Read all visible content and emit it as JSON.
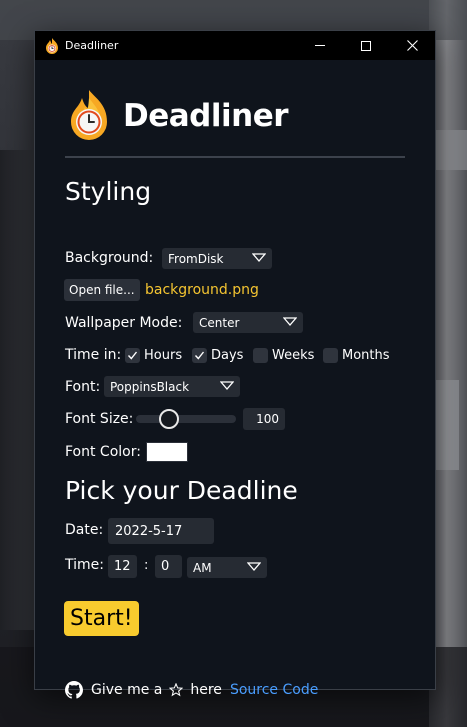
{
  "window": {
    "title": "Deadliner"
  },
  "header": {
    "app_name": "Deadliner"
  },
  "styling": {
    "heading": "Styling",
    "background_label": "Background:",
    "background_value": "FromDisk",
    "open_file_label": "Open file...",
    "file_name": "background.png",
    "wallpaper_mode_label": "Wallpaper Mode:",
    "wallpaper_mode_value": "Center",
    "time_in_label": "Time in:",
    "time_units": [
      {
        "label": "Hours",
        "checked": true
      },
      {
        "label": "Days",
        "checked": true
      },
      {
        "label": "Weeks",
        "checked": false
      },
      {
        "label": "Months",
        "checked": false
      }
    ],
    "font_label": "Font:",
    "font_value": "PoppinsBlack",
    "font_size_label": "Font Size:",
    "font_size_value": "100",
    "font_size_slider_level": 0.33,
    "font_color_label": "Font Color:",
    "font_color_value": "#ffffff"
  },
  "deadline": {
    "heading": "Pick your Deadline",
    "date_label": "Date:",
    "date_value": "2022-5-17",
    "time_label": "Time:",
    "hour_value": "12",
    "separator": ":",
    "minute_value": "0",
    "ampm_value": "AM"
  },
  "start_label": "Start!",
  "footer": {
    "text_before": "Give me a",
    "text_after": "here",
    "link_label": "Source Code"
  },
  "colors": {
    "accent": "#f8cb2e",
    "link": "#4a9eff",
    "window_bg": "#0f141c"
  }
}
